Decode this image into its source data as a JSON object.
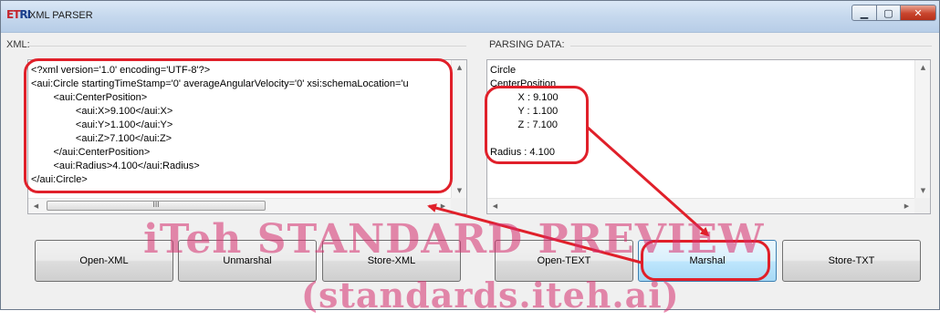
{
  "window": {
    "title": "XML PARSER",
    "icon_text_red": "ET",
    "icon_text_blue": "RI",
    "minimize_glyph": "▁",
    "maximize_glyph": "▢",
    "close_glyph": "✕"
  },
  "xml_panel": {
    "label": "XML:",
    "content": "<?xml version='1.0' encoding='UTF-8'?>\n<aui:Circle startingTimeStamp='0' averageAngularVelocity='0' xsi:schemaLocation='u\n        <aui:CenterPosition>\n                <aui:X>9.100</aui:X>\n                <aui:Y>1.100</aui:Y>\n                <aui:Z>7.100</aui:Z>\n        </aui:CenterPosition>\n        <aui:Radius>4.100</aui:Radius>\n</aui:Circle>",
    "hscroll_grip": "III"
  },
  "parsing_panel": {
    "label": "PARSING DATA:",
    "content": "Circle\nCenterPosition\n          X : 9.100\n          Y : 1.100\n          Z : 7.100\n\nRadius : 4.100"
  },
  "buttons": {
    "open_xml": "Open-XML",
    "unmarshal": "Unmarshal",
    "store_xml": "Store-XML",
    "open_text": "Open-TEXT",
    "marshal": "Marshal",
    "store_txt": "Store-TXT"
  },
  "watermark": {
    "line1": "iTeh STANDARD PREVIEW",
    "line2": "(standards.iteh.ai)"
  },
  "colors": {
    "annotation_red": "#e0202a",
    "watermark_pink": "#d62e6e"
  }
}
